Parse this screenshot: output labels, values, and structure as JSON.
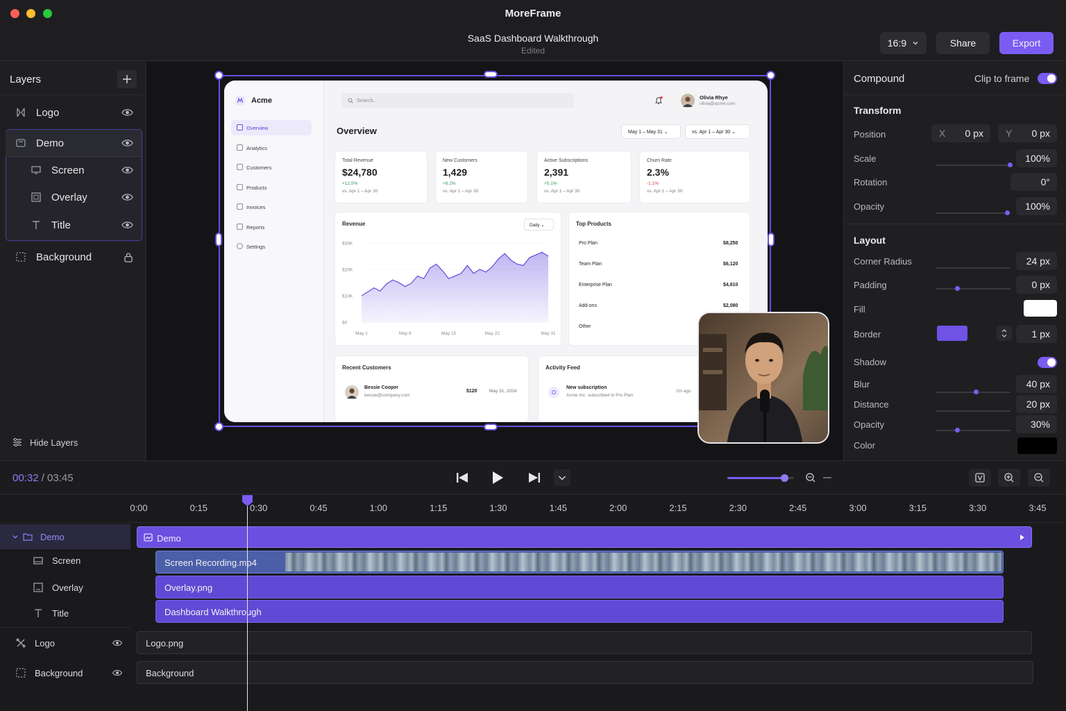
{
  "app": {
    "title": "MoreFrame"
  },
  "document": {
    "title": "SaaS Dashboard Walkthrough",
    "status": "Edited"
  },
  "toolbar": {
    "aspect": "16:9",
    "share": "Share",
    "export": "Export"
  },
  "layers": {
    "title": "Layers",
    "items": [
      {
        "label": "Logo",
        "icon": "logo-icon"
      },
      {
        "label": "Demo",
        "icon": "group-icon"
      },
      {
        "label": "Screen",
        "icon": "screen-icon"
      },
      {
        "label": "Overlay",
        "icon": "overlay-icon"
      },
      {
        "label": "Title",
        "icon": "text-icon"
      },
      {
        "label": "Background",
        "icon": "background-icon"
      }
    ],
    "hide_label": "Hide Layers"
  },
  "dashboard": {
    "brand": "Acme",
    "search_placeholder": "Search...",
    "user": {
      "name": "Olivia Rhye",
      "email": "olivia@acme.com"
    },
    "nav": [
      "Overview",
      "Analytics",
      "Customers",
      "Products",
      "Invoices",
      "Reports",
      "Settings"
    ],
    "heading": "Overview",
    "range1": "May 1 – May 31",
    "range2": "vs. Apr 1 – Apr 30",
    "stats": [
      {
        "label": "Total Revenue",
        "value": "$24,780",
        "delta": "+12.5%",
        "period": "vs. Apr 1 – Apr 30",
        "color": "#2e9b4f"
      },
      {
        "label": "New Customers",
        "value": "1,429",
        "delta": "+8.2%",
        "period": "vs. Apr 1 – Apr 30",
        "color": "#2e9b4f"
      },
      {
        "label": "Active Subscriptions",
        "value": "2,391",
        "delta": "+5.1%",
        "period": "vs. Apr 1 – Apr 30",
        "color": "#2e9b4f"
      },
      {
        "label": "Churn Rate",
        "value": "2.3%",
        "delta": "-1.1%",
        "period": "vs. Apr 1 – Apr 30",
        "color": "#d0453a"
      }
    ],
    "revenue": {
      "title": "Revenue",
      "granularity": "Daily",
      "y_ticks": [
        "$30K",
        "$20K",
        "$10K",
        "$0"
      ],
      "x_ticks": [
        "May 1",
        "May 8",
        "May 15",
        "May 22",
        "May 31"
      ]
    },
    "top_products": {
      "title": "Top Products",
      "rows": [
        {
          "name": "Pro Plan",
          "value": "$8,250"
        },
        {
          "name": "Team Plan",
          "value": "$6,120"
        },
        {
          "name": "Enterprise Plan",
          "value": "$4,810"
        },
        {
          "name": "Add-ons",
          "value": "$2,080"
        },
        {
          "name": "Other",
          "value": ""
        }
      ]
    },
    "recent": {
      "title": "Recent Customers",
      "name": "Bessie Cooper",
      "email": "bessie@company.com",
      "amount": "$120",
      "date": "May 31, 2024"
    },
    "activity": {
      "title": "Activity Feed",
      "event": "New subscription",
      "detail": "Acme Inc. subscribed to Pro Plan",
      "time": "2m ago"
    }
  },
  "chart_data": {
    "type": "area",
    "x": [
      "May 1",
      "May 2",
      "May 3",
      "May 4",
      "May 5",
      "May 6",
      "May 7",
      "May 8",
      "May 9",
      "May 10",
      "May 11",
      "May 12",
      "May 13",
      "May 14",
      "May 15",
      "May 16",
      "May 17",
      "May 18",
      "May 19",
      "May 20",
      "May 21",
      "May 22",
      "May 23",
      "May 24",
      "May 25",
      "May 26",
      "May 27",
      "May 28",
      "May 29",
      "May 30",
      "May 31"
    ],
    "values": [
      10000,
      11500,
      13000,
      11800,
      14500,
      16000,
      15000,
      13500,
      14800,
      17500,
      16500,
      20500,
      22000,
      19500,
      16500,
      17500,
      18500,
      21500,
      18500,
      20000,
      19000,
      21000,
      24000,
      26000,
      23500,
      22000,
      21500,
      24500,
      25500,
      26500,
      25000
    ],
    "ylim": [
      0,
      30000
    ],
    "fill_color": "#8b7ae8"
  },
  "inspector": {
    "compound": "Compound",
    "clip_to_frame": "Clip to frame",
    "transform": "Transform",
    "position": "Position",
    "pos_x_label": "X",
    "pos_x": "0 px",
    "pos_y_label": "Y",
    "pos_y": "0 px",
    "scale": "Scale",
    "scale_value": "100%",
    "rotation": "Rotation",
    "rotation_value": "0°",
    "opacity": "Opacity",
    "opacity_value": "100%",
    "layout": "Layout",
    "corner_radius": "Corner Radius",
    "corner_radius_value": "24 px",
    "padding": "Padding",
    "padding_value": "0 px",
    "fill": "Fill",
    "fill_color": "#ffffff",
    "border": "Border",
    "border_color": "#6f52e6",
    "border_value": "1 px",
    "shadow": "Shadow",
    "blur": "Blur",
    "blur_value": "40 px",
    "distance": "Distance",
    "distance_value": "20 px",
    "shadow_opacity": "Opacity",
    "shadow_opacity_value": "30%",
    "color": "Color",
    "shadow_color": "#000000",
    "scale_level": 1.0,
    "opacity_level": 1.0,
    "padding_level": 0.3,
    "blur_level": 0.55,
    "shadow_opacity_level": 0.3
  },
  "playback": {
    "current": "00:32",
    "total": "/ 03:45",
    "zoom_level": 0.85
  },
  "timeline": {
    "ticks": [
      "0:00",
      "0:15",
      "0:30",
      "0:45",
      "1:00",
      "1:15",
      "1:30",
      "1:45",
      "2:00",
      "2:15",
      "2:30",
      "2:45",
      "3:00",
      "3:15",
      "3:30",
      "3:45"
    ],
    "tracks": [
      {
        "label": "Demo"
      },
      {
        "label": "Screen"
      },
      {
        "label": "Overlay"
      },
      {
        "label": "Title"
      },
      {
        "label": "Logo"
      },
      {
        "label": "Background"
      }
    ],
    "clips": {
      "demo": "Demo",
      "screen": "Screen Recording.mp4",
      "overlay": "Overlay.png",
      "title": "Dashboard Walkthrough",
      "logo": "Logo.png",
      "background": "Background"
    }
  },
  "colors": {
    "accent": "#7b5cf2",
    "clip": "#5d44c7",
    "clip_dark": "#4a3aa8"
  }
}
